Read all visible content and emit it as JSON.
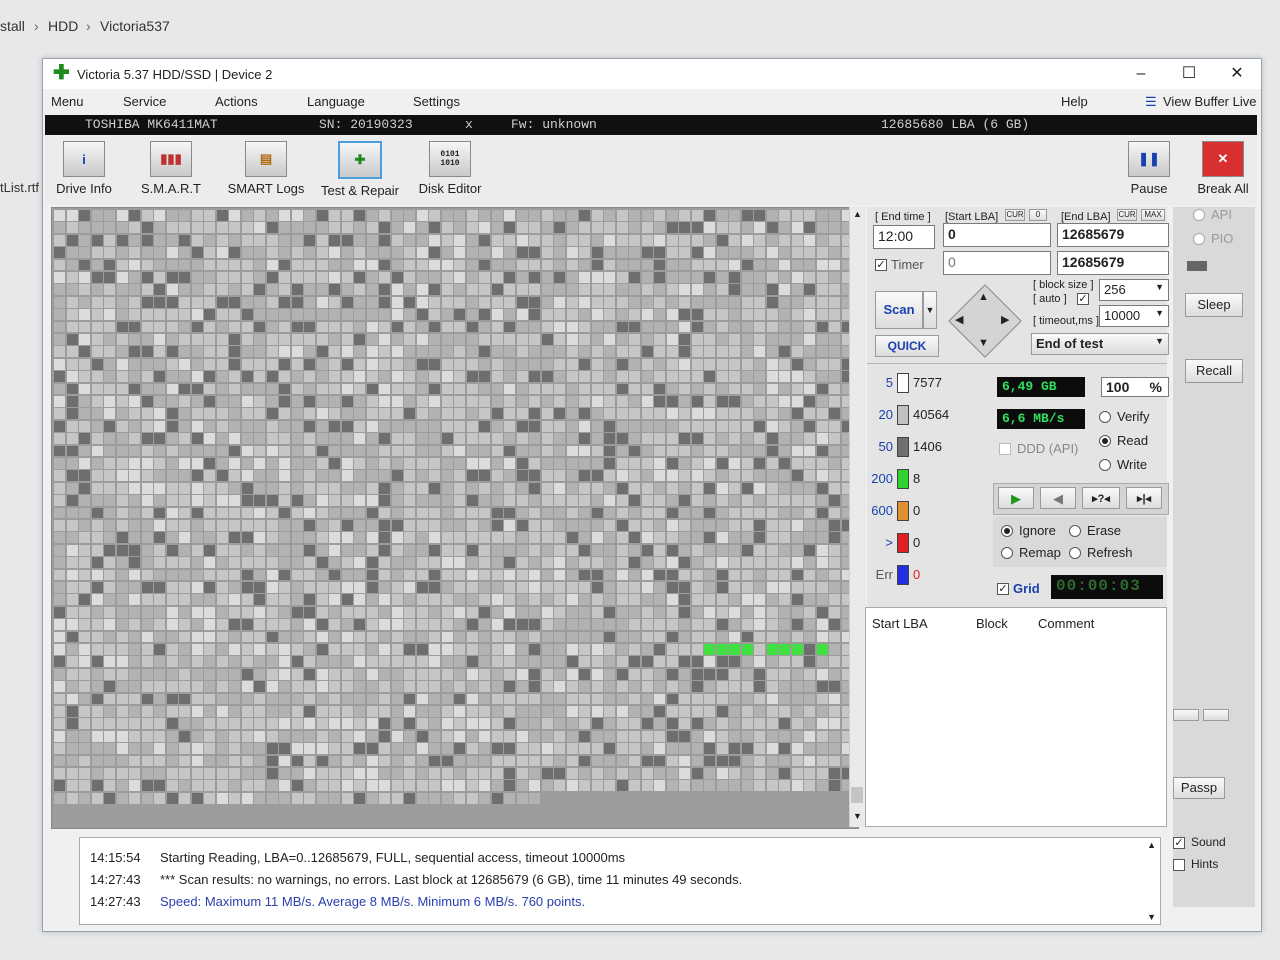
{
  "breadcrumb": {
    "items": [
      "stall",
      "HDD",
      "Victoria537"
    ]
  },
  "desktop": {
    "file_label": "tList.rtf"
  },
  "window": {
    "title": "Victoria 5.37 HDD/SSD | Device 2"
  },
  "menu": {
    "items": [
      "Menu",
      "Service",
      "Actions",
      "Language",
      "Settings"
    ],
    "help": "Help",
    "view_buffer": "View Buffer Live"
  },
  "device": {
    "model": "TOSHIBA MK6411MAT",
    "serial": "SN: 20190323",
    "sep": "x",
    "firmware": "Fw: unknown",
    "capacity": "12685680 LBA (6 GB)"
  },
  "toolbar": {
    "items": [
      "Drive Info",
      "S.M.A.R.T",
      "SMART Logs",
      "Test & Repair",
      "Disk Editor"
    ],
    "pause": "Pause",
    "break_all": "Break All"
  },
  "test": {
    "end_time_label": "[ End time ]",
    "end_time": "12:00",
    "start_lba_label": "[Start LBA]",
    "cur": "CUR",
    "zero": "0",
    "end_lba_label": "[End LBA]",
    "max": "MAX",
    "start_lba": "0",
    "end_lba": "12685679",
    "timer_label": "Timer",
    "timer_start": "0",
    "timer_end": "12685679",
    "scan": "Scan",
    "quick": "QUICK",
    "block_size_label": "[ block size ]",
    "auto_label": "[ auto ]",
    "block_size": "256",
    "timeout_label": "[ timeout,ms ]",
    "timeout": "10000",
    "end_action": "End of test",
    "size_done": "6,49 GB",
    "percent": "100",
    "percent_sign": "%",
    "speed": "6,6 MB/s",
    "ddd": "DDD (API)",
    "modes": [
      "Verify",
      "Read",
      "Write"
    ],
    "selected_mode": "Read",
    "repair": [
      "Ignore",
      "Erase",
      "Remap",
      "Refresh"
    ],
    "selected_repair": "Ignore",
    "grid_label": "Grid",
    "elapsed": "00:00:03"
  },
  "counters": [
    {
      "label": "5",
      "value": "7577",
      "color": "#ffffff"
    },
    {
      "label": "20",
      "value": "40564",
      "color": "#c0c0c0"
    },
    {
      "label": "50",
      "value": "1406",
      "color": "#707070"
    },
    {
      "label": "200",
      "value": "8",
      "color": "#30d030"
    },
    {
      "label": "600",
      "value": "0",
      "color": "#e09030"
    },
    {
      "label": ">",
      "value": "0",
      "color": "#e02020"
    },
    {
      "label": "Err",
      "value": "0",
      "color": "#2030e0"
    }
  ],
  "results_table": {
    "columns": [
      "Start LBA",
      "Block",
      "Comment"
    ]
  },
  "side": {
    "api": "API",
    "pio": "PIO",
    "sleep": "Sleep",
    "recall": "Recall",
    "passp": "Passp",
    "sound": "Sound",
    "hints": "Hints"
  },
  "log": [
    {
      "time": "14:15:54",
      "text": "Starting Reading, LBA=0..12685679, FULL, sequential access, timeout 10000ms",
      "color": "#222222"
    },
    {
      "time": "14:27:43",
      "text": "*** Scan results: no warnings, no errors. Last block at 12685679 (6 GB), time 11 minutes 49 seconds.",
      "color": "#222222"
    },
    {
      "time": "14:27:43",
      "text": "Speed: Maximum 11 MB/s. Average 8 MB/s. Minimum 6 MB/s. 760 points.",
      "color": "#2a3fae"
    }
  ],
  "colors": {
    "accent_blue": "#1a3fb0",
    "green_text": "#30e060",
    "block_green": "#40e040"
  }
}
